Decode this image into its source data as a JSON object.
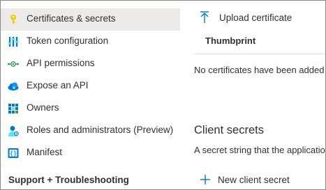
{
  "sidebar": {
    "items": [
      {
        "label": "Certificates & secrets",
        "icon": "key-icon",
        "selected": true
      },
      {
        "label": "Token configuration",
        "icon": "token-config-icon"
      },
      {
        "label": "API permissions",
        "icon": "api-permissions-icon"
      },
      {
        "label": "Expose an API",
        "icon": "cloud-icon"
      },
      {
        "label": "Owners",
        "icon": "owners-grid-icon"
      },
      {
        "label": "Roles and administrators (Preview)",
        "icon": "user-roles-icon"
      },
      {
        "label": "Manifest",
        "icon": "manifest-icon"
      }
    ],
    "section_header": "Support + Troubleshooting"
  },
  "main": {
    "upload_label": "Upload certificate",
    "thumbprint_header": "Thumbprint",
    "no_certs_text": "No certificates have been added",
    "client_secrets_title": "Client secrets",
    "client_secrets_desc": "A secret string that the application",
    "new_secret_label": "New client secret"
  },
  "colors": {
    "accent": "#0078d4",
    "selected_bg": "#edebe9",
    "key_yellow": "#f2c811"
  }
}
